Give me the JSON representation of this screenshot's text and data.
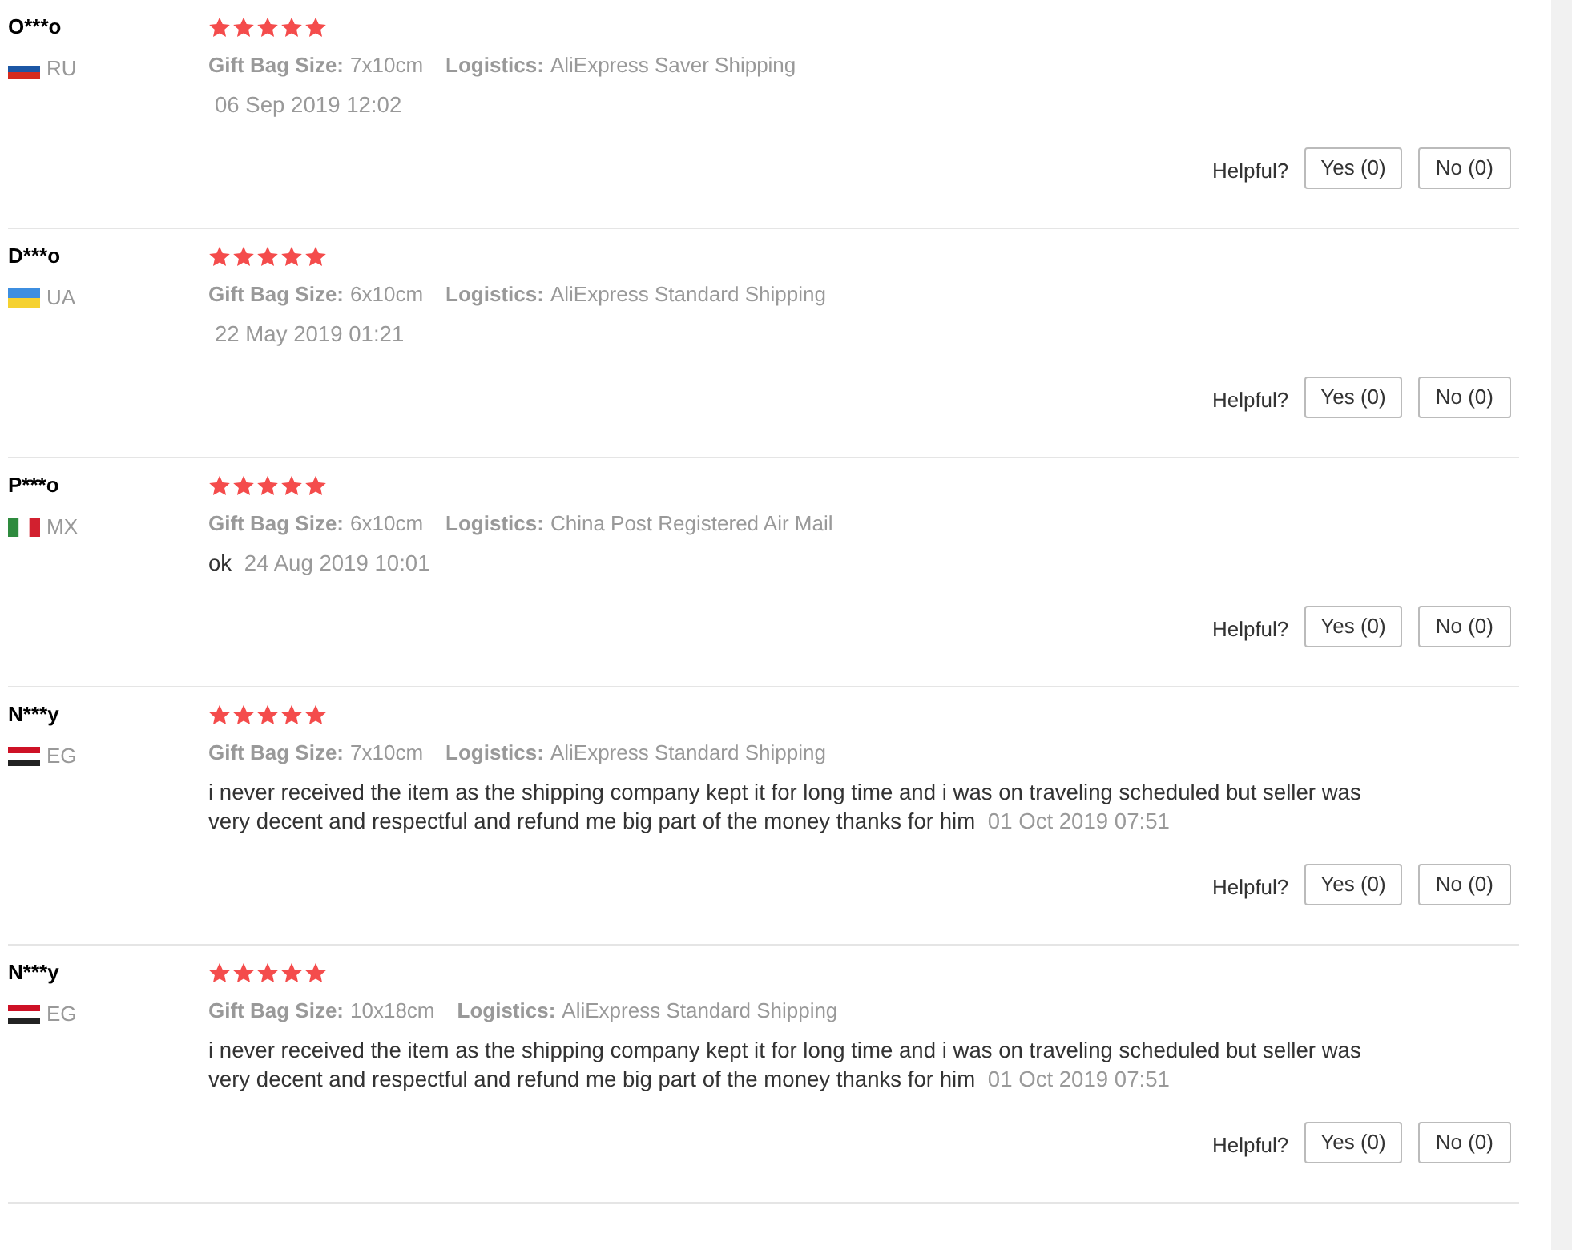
{
  "reviews": [
    {
      "name": "O***o",
      "country": "RU",
      "flag": {
        "kind": "ru"
      },
      "stars": 5,
      "gift_bag_label": "Gift Bag Size:",
      "gift_bag_size": "7x10cm",
      "logistics_label": "Logistics:",
      "logistics": "AliExpress Saver Shipping",
      "date": "06 Sep 2019 12:02",
      "helpful_label": "Helpful?",
      "yes_button": "Yes (0)",
      "no_button": "No (0)"
    },
    {
      "name": "D***o",
      "country": "UA",
      "flag": {
        "kind": "ua"
      },
      "stars": 5,
      "gift_bag_label": "Gift Bag Size:",
      "gift_bag_size": "6x10cm",
      "logistics_label": "Logistics:",
      "logistics": "AliExpress Standard Shipping",
      "date": "22 May 2019 01:21",
      "helpful_label": "Helpful?",
      "yes_button": "Yes (0)",
      "no_button": "No (0)"
    },
    {
      "name": "P***o",
      "country": "MX",
      "flag": {
        "kind": "mx"
      },
      "stars": 5,
      "gift_bag_label": "Gift Bag Size:",
      "gift_bag_size": "6x10cm",
      "logistics_label": "Logistics:",
      "logistics": "China Post Registered Air Mail",
      "comment": "ok",
      "date": "24 Aug 2019 10:01",
      "helpful_label": "Helpful?",
      "yes_button": "Yes (0)",
      "no_button": "No (0)"
    },
    {
      "name": "N***y",
      "country": "EG",
      "flag": {
        "kind": "eg"
      },
      "stars": 5,
      "gift_bag_label": "Gift Bag Size:",
      "gift_bag_size": "7x10cm",
      "logistics_label": "Logistics:",
      "logistics": "AliExpress Standard Shipping",
      "comment": "i never received the item as the shipping company kept it for long time and i was on traveling scheduled but seller was very decent and respectful and refund me big part of the money thanks for him",
      "date": "01 Oct 2019 07:51",
      "helpful_label": "Helpful?",
      "yes_button": "Yes (0)",
      "no_button": "No (0)"
    },
    {
      "name": "N***y",
      "country": "EG",
      "flag": {
        "kind": "eg"
      },
      "stars": 5,
      "gift_bag_label": "Gift Bag Size:",
      "gift_bag_size": "10x18cm",
      "logistics_label": "Logistics:",
      "logistics": "AliExpress Standard Shipping",
      "comment": "i never received the item as the shipping company kept it for long time and i was on traveling scheduled but seller was very decent and respectful and refund me big part of the money thanks for him",
      "date": "01 Oct 2019 07:51",
      "helpful_label": "Helpful?",
      "yes_button": "Yes (0)",
      "no_button": "No (0)"
    }
  ]
}
